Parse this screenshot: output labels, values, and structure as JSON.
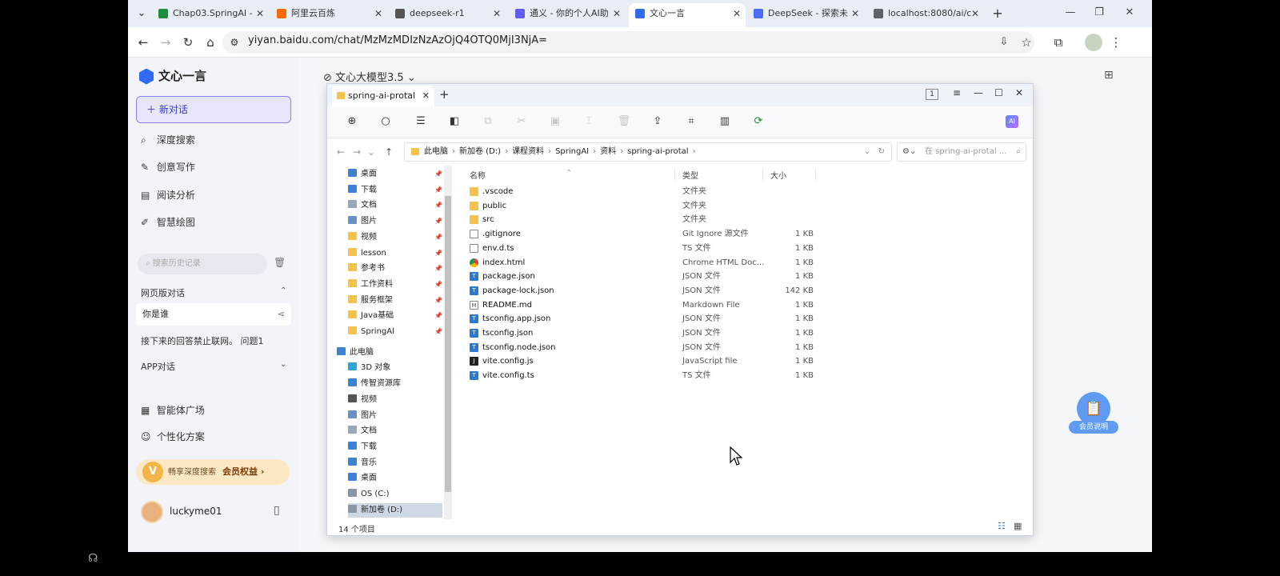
{
  "browser": {
    "tabs": [
      {
        "label": "Chap03.SpringAI -",
        "color": "#1e8e3e"
      },
      {
        "label": "阿里云百炼",
        "color": "#ff6a00"
      },
      {
        "label": "deepseek-r1",
        "color": "#555555"
      },
      {
        "label": "通义 - 你的个人AI助",
        "color": "#615ced"
      },
      {
        "label": "文心一言",
        "color": "#2f6bf3"
      },
      {
        "label": "DeepSeek - 探索未",
        "color": "#4d6bfe"
      },
      {
        "label": "localhost:8080/ai/c",
        "color": "#5f6368"
      }
    ],
    "active_tab": 4,
    "url": "yiyan.baidu.com/chat/MzMzMDIzNzAzOjQ4OTQ0MjI3NjA="
  },
  "sidebar": {
    "logo": "文心一言",
    "new_chat": "新对话",
    "items": [
      "深度搜索",
      "创意写作",
      "阅读分析",
      "智慧绘图"
    ],
    "history_placeholder": "搜索历史记录",
    "web_section": "网页版对话",
    "conversations": [
      "你是谁",
      "接下来的回答禁止联网。 问题1"
    ],
    "app_section": "APP对话",
    "bottom_items": [
      "智能体广场",
      "个性化方案"
    ],
    "vip_text": "畅享深度搜索",
    "vip_link": "会员权益 ›",
    "username": "luckyme01"
  },
  "main": {
    "model": "文心大模型3.5"
  },
  "explorer": {
    "tab_title": "spring-ai-protal",
    "badge": "1",
    "breadcrumb": [
      "此电脑",
      "新加卷 (D:)",
      "课程资料",
      "SpringAI",
      "资料",
      "spring-ai-protal"
    ],
    "search_placeholder": "在 spring-ai-protal ...",
    "nav_quick": [
      "桌面",
      "下载",
      "文档",
      "图片",
      "视频",
      "lesson",
      "参考书",
      "工作资料",
      "服务框架",
      "Java基础",
      "SpringAI"
    ],
    "nav_pc_label": "此电脑",
    "nav_pc": [
      "3D 对象",
      "传智资源库",
      "视频",
      "图片",
      "文档",
      "下载",
      "音乐",
      "桌面",
      "OS (C:)",
      "新加卷 (D:)"
    ],
    "columns": {
      "name": "名称",
      "type": "类型",
      "size": "大小"
    },
    "files": [
      {
        "name": ".vscode",
        "type": "文件夹",
        "size": "",
        "icon": "folder"
      },
      {
        "name": "public",
        "type": "文件夹",
        "size": "",
        "icon": "folder"
      },
      {
        "name": "src",
        "type": "文件夹",
        "size": "",
        "icon": "folder"
      },
      {
        "name": ".gitignore",
        "type": "Git Ignore 源文件",
        "size": "1 KB",
        "icon": "file"
      },
      {
        "name": "env.d.ts",
        "type": "TS 文件",
        "size": "1 KB",
        "icon": "file"
      },
      {
        "name": "index.html",
        "type": "Chrome HTML Doc...",
        "size": "1 KB",
        "icon": "chrome"
      },
      {
        "name": "package.json",
        "type": "JSON 文件",
        "size": "1 KB",
        "icon": "vscode"
      },
      {
        "name": "package-lock.json",
        "type": "JSON 文件",
        "size": "142 KB",
        "icon": "vscode"
      },
      {
        "name": "README.md",
        "type": "Markdown File",
        "size": "1 KB",
        "icon": "md"
      },
      {
        "name": "tsconfig.app.json",
        "type": "JSON 文件",
        "size": "1 KB",
        "icon": "vscode"
      },
      {
        "name": "tsconfig.json",
        "type": "JSON 文件",
        "size": "1 KB",
        "icon": "vscode"
      },
      {
        "name": "tsconfig.node.json",
        "type": "JSON 文件",
        "size": "1 KB",
        "icon": "vscode"
      },
      {
        "name": "vite.config.js",
        "type": "JavaScript file",
        "size": "1 KB",
        "icon": "js"
      },
      {
        "name": "vite.config.ts",
        "type": "TS 文件",
        "size": "1 KB",
        "icon": "vscode"
      }
    ],
    "status": "14 个项目"
  },
  "helper_label": "会员说明"
}
